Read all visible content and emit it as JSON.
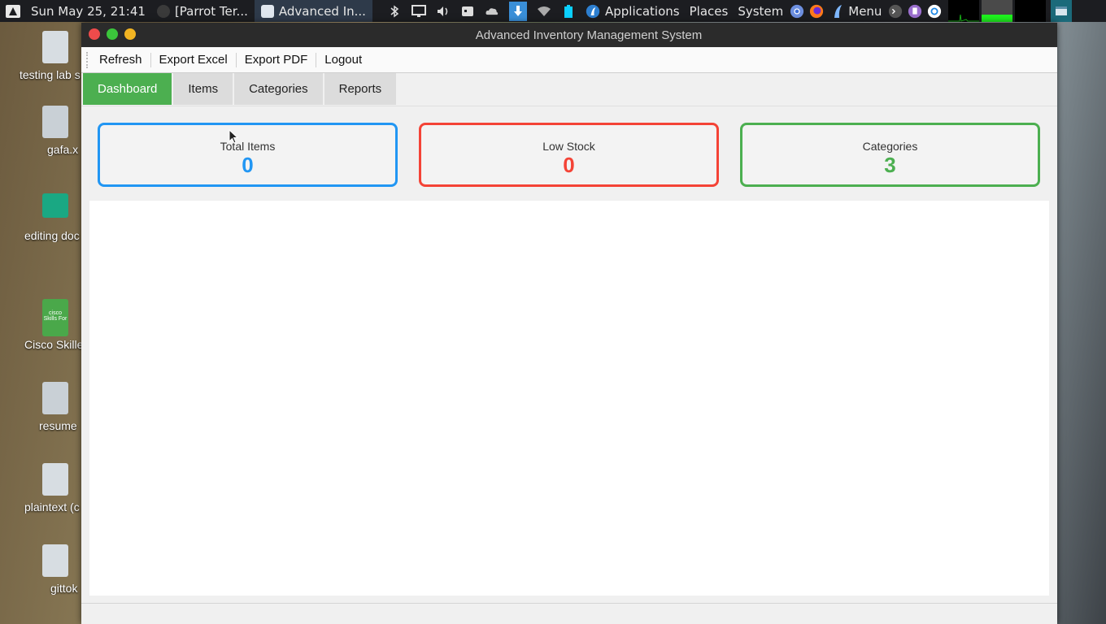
{
  "top_panel": {
    "clock": "Sun May 25, 21:41",
    "tasks": [
      {
        "label": "[Parrot Ter...",
        "icon": "terminal-icon"
      },
      {
        "label": "Advanced In...",
        "icon": "window-icon"
      }
    ],
    "menus": {
      "applications": "Applications",
      "places": "Places",
      "system": "System",
      "menu": "Menu"
    },
    "tray_icons": [
      "bluetooth-icon",
      "display-icon",
      "volume-icon",
      "keyboard-icon",
      "cloud-icon",
      "download-icon",
      "wifi-icon",
      "battery-icon"
    ],
    "launcher_icons": [
      "chromium-icon",
      "firefox-icon",
      "parrot-icon",
      "terminal-icon",
      "text-editor-icon",
      "settings-icon"
    ]
  },
  "desktop": {
    "icons": [
      {
        "label": "testing lab s",
        "icon": "text-file-icon"
      },
      {
        "label": "gafa.x",
        "icon": "audio-file-icon"
      },
      {
        "label": "editing doc",
        "icon": "folder-icon"
      },
      {
        "label": "Cisco Skille",
        "icon": "cisco-app-icon"
      },
      {
        "label": "resume",
        "icon": "audio-file-icon"
      },
      {
        "label": "plaintext (c",
        "icon": "text-file-icon"
      },
      {
        "label": "gittok",
        "icon": "text-file-icon"
      }
    ],
    "cisco_icon_text": {
      "brand": "cisco",
      "sub": "Skills For"
    }
  },
  "window": {
    "title": "Advanced Inventory Management System",
    "toolbar": [
      "Refresh",
      "Export Excel",
      "Export PDF",
      "Logout"
    ],
    "tabs": [
      {
        "label": "Dashboard",
        "active": true
      },
      {
        "label": "Items",
        "active": false
      },
      {
        "label": "Categories",
        "active": false
      },
      {
        "label": "Reports",
        "active": false
      }
    ],
    "stats": [
      {
        "label": "Total Items",
        "value": "0",
        "color": "#2196f3"
      },
      {
        "label": "Low Stock",
        "value": "0",
        "color": "#f44336"
      },
      {
        "label": "Categories",
        "value": "3",
        "color": "#4caf50"
      }
    ]
  }
}
